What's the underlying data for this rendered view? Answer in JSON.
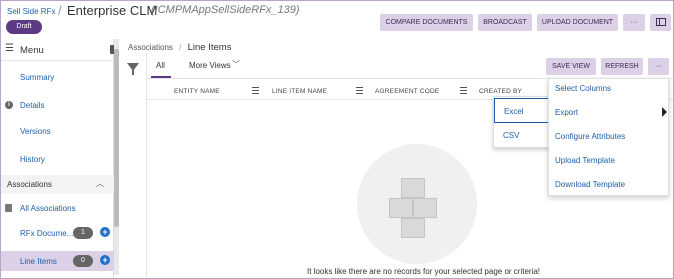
{
  "header": {
    "breadcrumb": "Sell Side RFx",
    "separator": "/",
    "title": "Enterprise CLM",
    "app_id": "(ICMPMAppSellSideRFx_139)",
    "status_badge": "Draft",
    "buttons": {
      "compare": "COMPARE DOCUMENTS",
      "broadcast": "BROADCAST",
      "upload": "UPLOAD DOCUMENT",
      "more": "···"
    }
  },
  "sidebar": {
    "menu_label": "Menu",
    "items": {
      "summary": "Summary",
      "details": "Details",
      "versions": "Versions",
      "history": "History"
    },
    "associations": {
      "label": "Associations",
      "all": "All Associations",
      "rfx_documents": {
        "label": "RFx Docume...",
        "count": "1"
      },
      "line_items": {
        "label": "Line Items",
        "count": "0"
      }
    }
  },
  "main": {
    "breadcrumb_parent": "Associations",
    "breadcrumb_sep": "/",
    "breadcrumb_current": "Line Items",
    "tabs": {
      "all": "All",
      "more_views": "More Views"
    },
    "buttons": {
      "save_view": "SAVE VIEW",
      "refresh": "REFRESH",
      "more": "···"
    },
    "columns": [
      "ENTITY NAME",
      "LINE ITEM NAME",
      "AGREEMENT CODE",
      "CREATED BY"
    ],
    "empty_message": "It looks like there are no records for your selected page or criteria!"
  },
  "export_menu": {
    "excel": "Excel",
    "csv": "CSV"
  },
  "more_menu": {
    "select_columns": "Select Columns",
    "export": "Export",
    "configure_attributes": "Configure Attributes",
    "upload_template": "Upload Template",
    "download_template": "Download Template"
  },
  "colors": {
    "accent": "#5d3b84",
    "button_bg": "#dcd0e6",
    "link": "#1f5fa8",
    "add_icon": "#1f6fc9"
  }
}
